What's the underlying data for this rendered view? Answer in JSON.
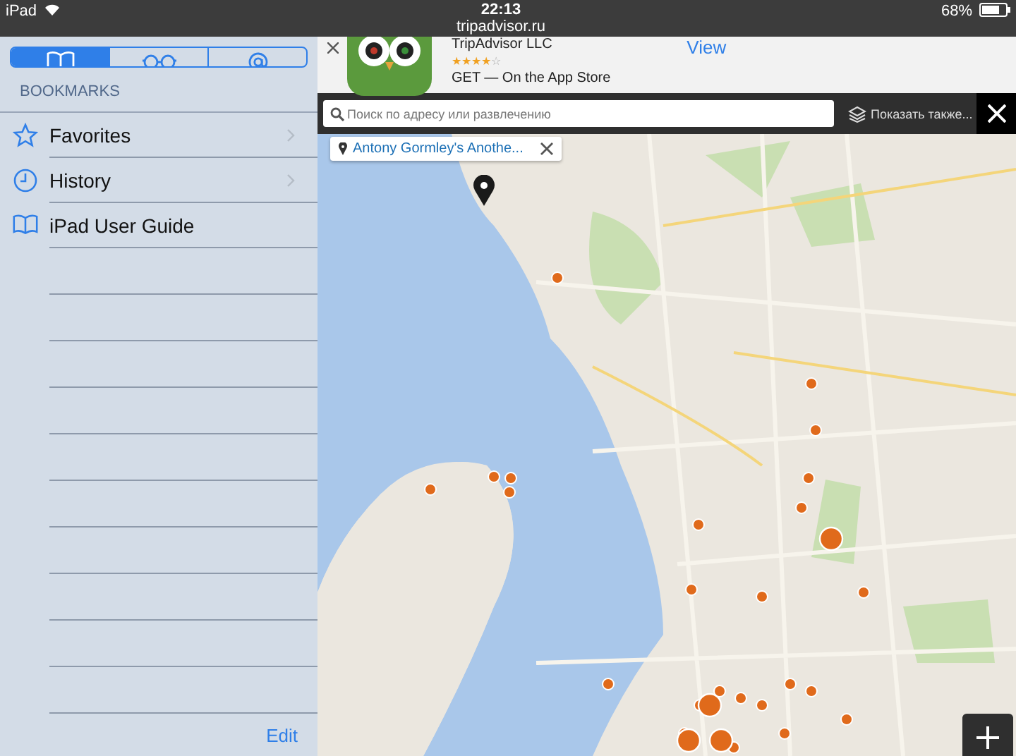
{
  "status_bar": {
    "device": "iPad",
    "time": "22:13",
    "url": "tripadvisor.ru",
    "battery": "68%"
  },
  "sidebar": {
    "tabs": [
      {
        "selected": true
      },
      {
        "selected": false
      },
      {
        "selected": false
      }
    ],
    "heading": "BOOKMARKS",
    "items": [
      {
        "label": "Favorites",
        "has_children": true
      },
      {
        "label": "History",
        "has_children": true
      },
      {
        "label": "iPad User Guide",
        "has_children": false
      }
    ],
    "edit": "Edit"
  },
  "app_banner": {
    "company": "TripAdvisor LLC",
    "stars": 4,
    "store": "GET — On the App Store",
    "action": "View"
  },
  "map_toolbar": {
    "search_placeholder": "Поиск по адресу или развлечению",
    "layers": "Показать также..."
  },
  "selected_place": {
    "name": "Antony Gormley's Anothe..."
  }
}
